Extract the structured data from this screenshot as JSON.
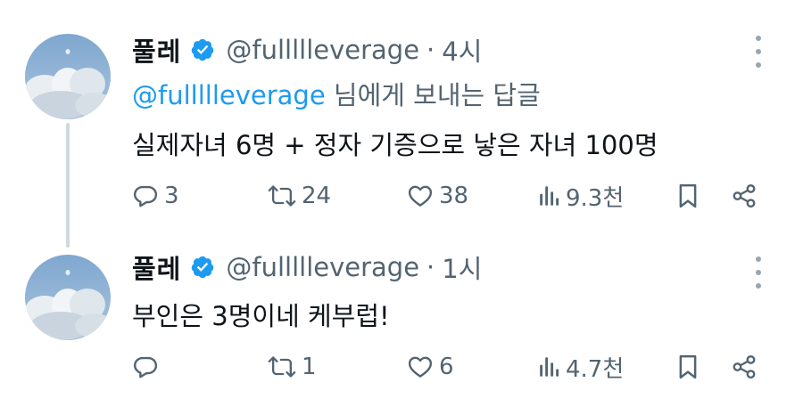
{
  "thread": [
    {
      "author": {
        "name": "풀레",
        "handle": "@fullllleverage",
        "avatar": "sky-clouds-avatar"
      },
      "time": "4시",
      "reply_to": {
        "mention": "@fullllleverage",
        "suffix": " 님에게 보내는 답글"
      },
      "text": "실제자녀 6명 + 정자 기증으로 낳은 자녀 100명",
      "actions": {
        "replies": "3",
        "retweets": "24",
        "likes": "38",
        "views": "9.3천"
      }
    },
    {
      "author": {
        "name": "풀레",
        "handle": "@fullllleverage",
        "avatar": "sky-clouds-avatar"
      },
      "time": "1시",
      "text": "부인은 3명이네 케부럽!",
      "actions": {
        "replies": "",
        "retweets": "1",
        "likes": "6",
        "views": "4.7천"
      }
    }
  ],
  "separator": "·",
  "icons": [
    "verified-badge-icon",
    "more-icon",
    "reply-icon",
    "retweet-icon",
    "like-icon",
    "views-icon",
    "bookmark-icon",
    "share-icon"
  ],
  "colors": {
    "text": "#0f1419",
    "secondary": "#536471",
    "accent": "#1d9bf0",
    "thread_line": "#cfd9de"
  }
}
